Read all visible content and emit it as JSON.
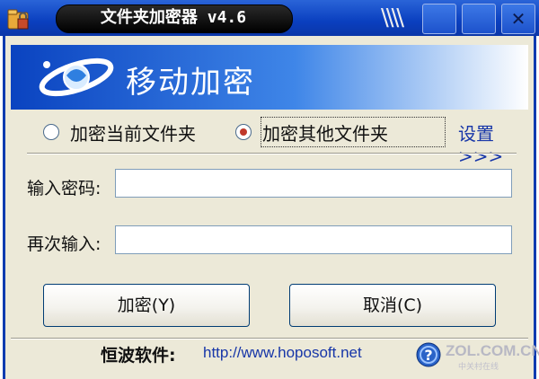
{
  "window": {
    "title": "文件夹加密器 v4.6",
    "close_glyph": "✕",
    "grip_glyph": "\\\\\\\\"
  },
  "banner": {
    "title": "移动加密"
  },
  "mode": {
    "options": [
      {
        "label": "加密当前文件夹",
        "checked": false
      },
      {
        "label": "加密其他文件夹",
        "checked": true
      }
    ],
    "settings_link": "设置>>>"
  },
  "form": {
    "password_label": "输入密码:",
    "password_value": "",
    "confirm_label": "再次输入:",
    "confirm_value": ""
  },
  "actions": {
    "encrypt_label": "加密(Y)",
    "cancel_label": "取消(C)"
  },
  "footer": {
    "company": "恒波软件:",
    "url": "http://www.hoposoft.net",
    "watermark": "ZOL.COM.CN",
    "watermark_sub": "中关村在线"
  },
  "colors": {
    "titlebar": "#0a3fbf",
    "banner_start": "#0a43c0",
    "window_bg": "#ece9d8",
    "link": "#1736a8",
    "radio_checked": "#c0392b"
  }
}
